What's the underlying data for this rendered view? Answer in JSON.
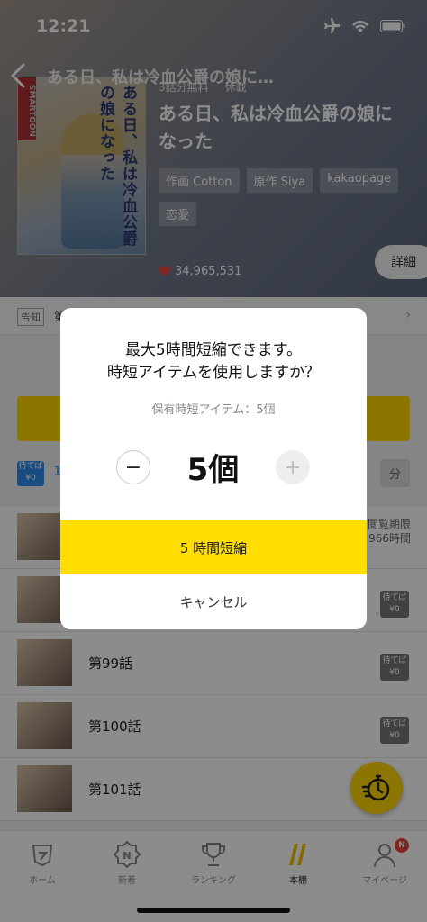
{
  "status_bar": {
    "time": "12:21"
  },
  "header": {
    "title": "ある日、私は冷血公爵の娘に…",
    "cover_label": "SMARTOON",
    "cover_title": "ある日、私は冷血公爵の娘になった"
  },
  "series": {
    "free_info": "3話分無料",
    "status": "休載",
    "title": "ある日、私は冷血公爵の娘になった",
    "chips": [
      "作画 Cotton",
      "原作 Siya",
      "kakaopage",
      "恋愛"
    ],
    "likes": "34,965,531",
    "detail_label": "詳細"
  },
  "notice": {
    "tag": "告知",
    "text": "第"
  },
  "wait_row": {
    "badge": "待てば ¥0",
    "count": "1",
    "right_label": "分"
  },
  "episodes": [
    {
      "name": "",
      "limit": "閲覧期限\n966時間"
    },
    {
      "name": "",
      "badge": "待てば ¥0"
    },
    {
      "name": "第99話",
      "badge": "待てば ¥0"
    },
    {
      "name": "第100話",
      "badge": "待てば ¥0"
    },
    {
      "name": "第101話",
      "badge": "待てば ¥0"
    }
  ],
  "dialog": {
    "title_line1": "最大5時間短縮できます。",
    "title_line2": "時短アイテムを使用しますか？",
    "owned": "保有時短アイテム：5個",
    "value": "5個",
    "minus": "−",
    "plus": "+",
    "confirm": "5 時間短縮",
    "cancel": "キャンセル"
  },
  "tabbar": {
    "items": [
      {
        "label": "ホーム",
        "icon": "home-icon"
      },
      {
        "label": "新着",
        "icon": "new-icon"
      },
      {
        "label": "ランキング",
        "icon": "trophy-icon"
      },
      {
        "label": "本棚",
        "icon": "bookshelf-icon"
      },
      {
        "label": "マイページ",
        "icon": "person-icon",
        "badge": "N"
      }
    ]
  },
  "colors": {
    "accent": "#ffdd00",
    "wait_blue": "#2d8cf0",
    "heart": "#e8453c"
  }
}
